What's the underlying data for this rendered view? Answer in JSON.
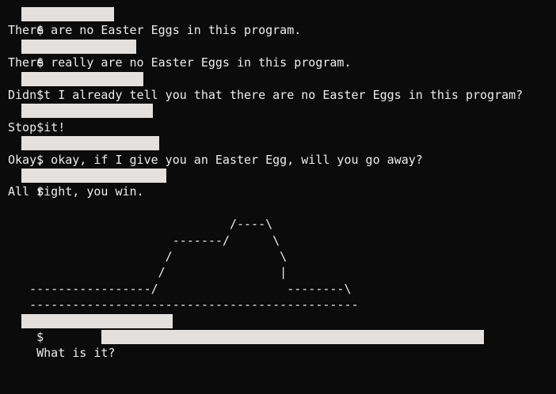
{
  "terminal": {
    "prompt": "$",
    "lines": [
      {
        "kind": "cmd"
      },
      {
        "kind": "out",
        "text": "There are no Easter Eggs in this program."
      },
      {
        "kind": "cmd"
      },
      {
        "kind": "out",
        "text": "There really are no Easter Eggs in this program."
      },
      {
        "kind": "cmd"
      },
      {
        "kind": "out",
        "text": "Didn't I already tell you that there are no Easter Eggs in this program?"
      },
      {
        "kind": "cmd"
      },
      {
        "kind": "out",
        "text": "Stop it!"
      },
      {
        "kind": "cmd"
      },
      {
        "kind": "out",
        "text": "Okay, okay, if I give you an Easter Egg, will you go away?"
      },
      {
        "kind": "cmd"
      },
      {
        "kind": "out",
        "text": "All right, you win."
      }
    ],
    "ascii_art": "\n                               /----\\\n                       -------/      \\\n                      /               \\\n                     /                |\n   -----------------/                  --------\\\n   ----------------------------------------------",
    "final_prompt": "$",
    "question": "What is it? "
  }
}
